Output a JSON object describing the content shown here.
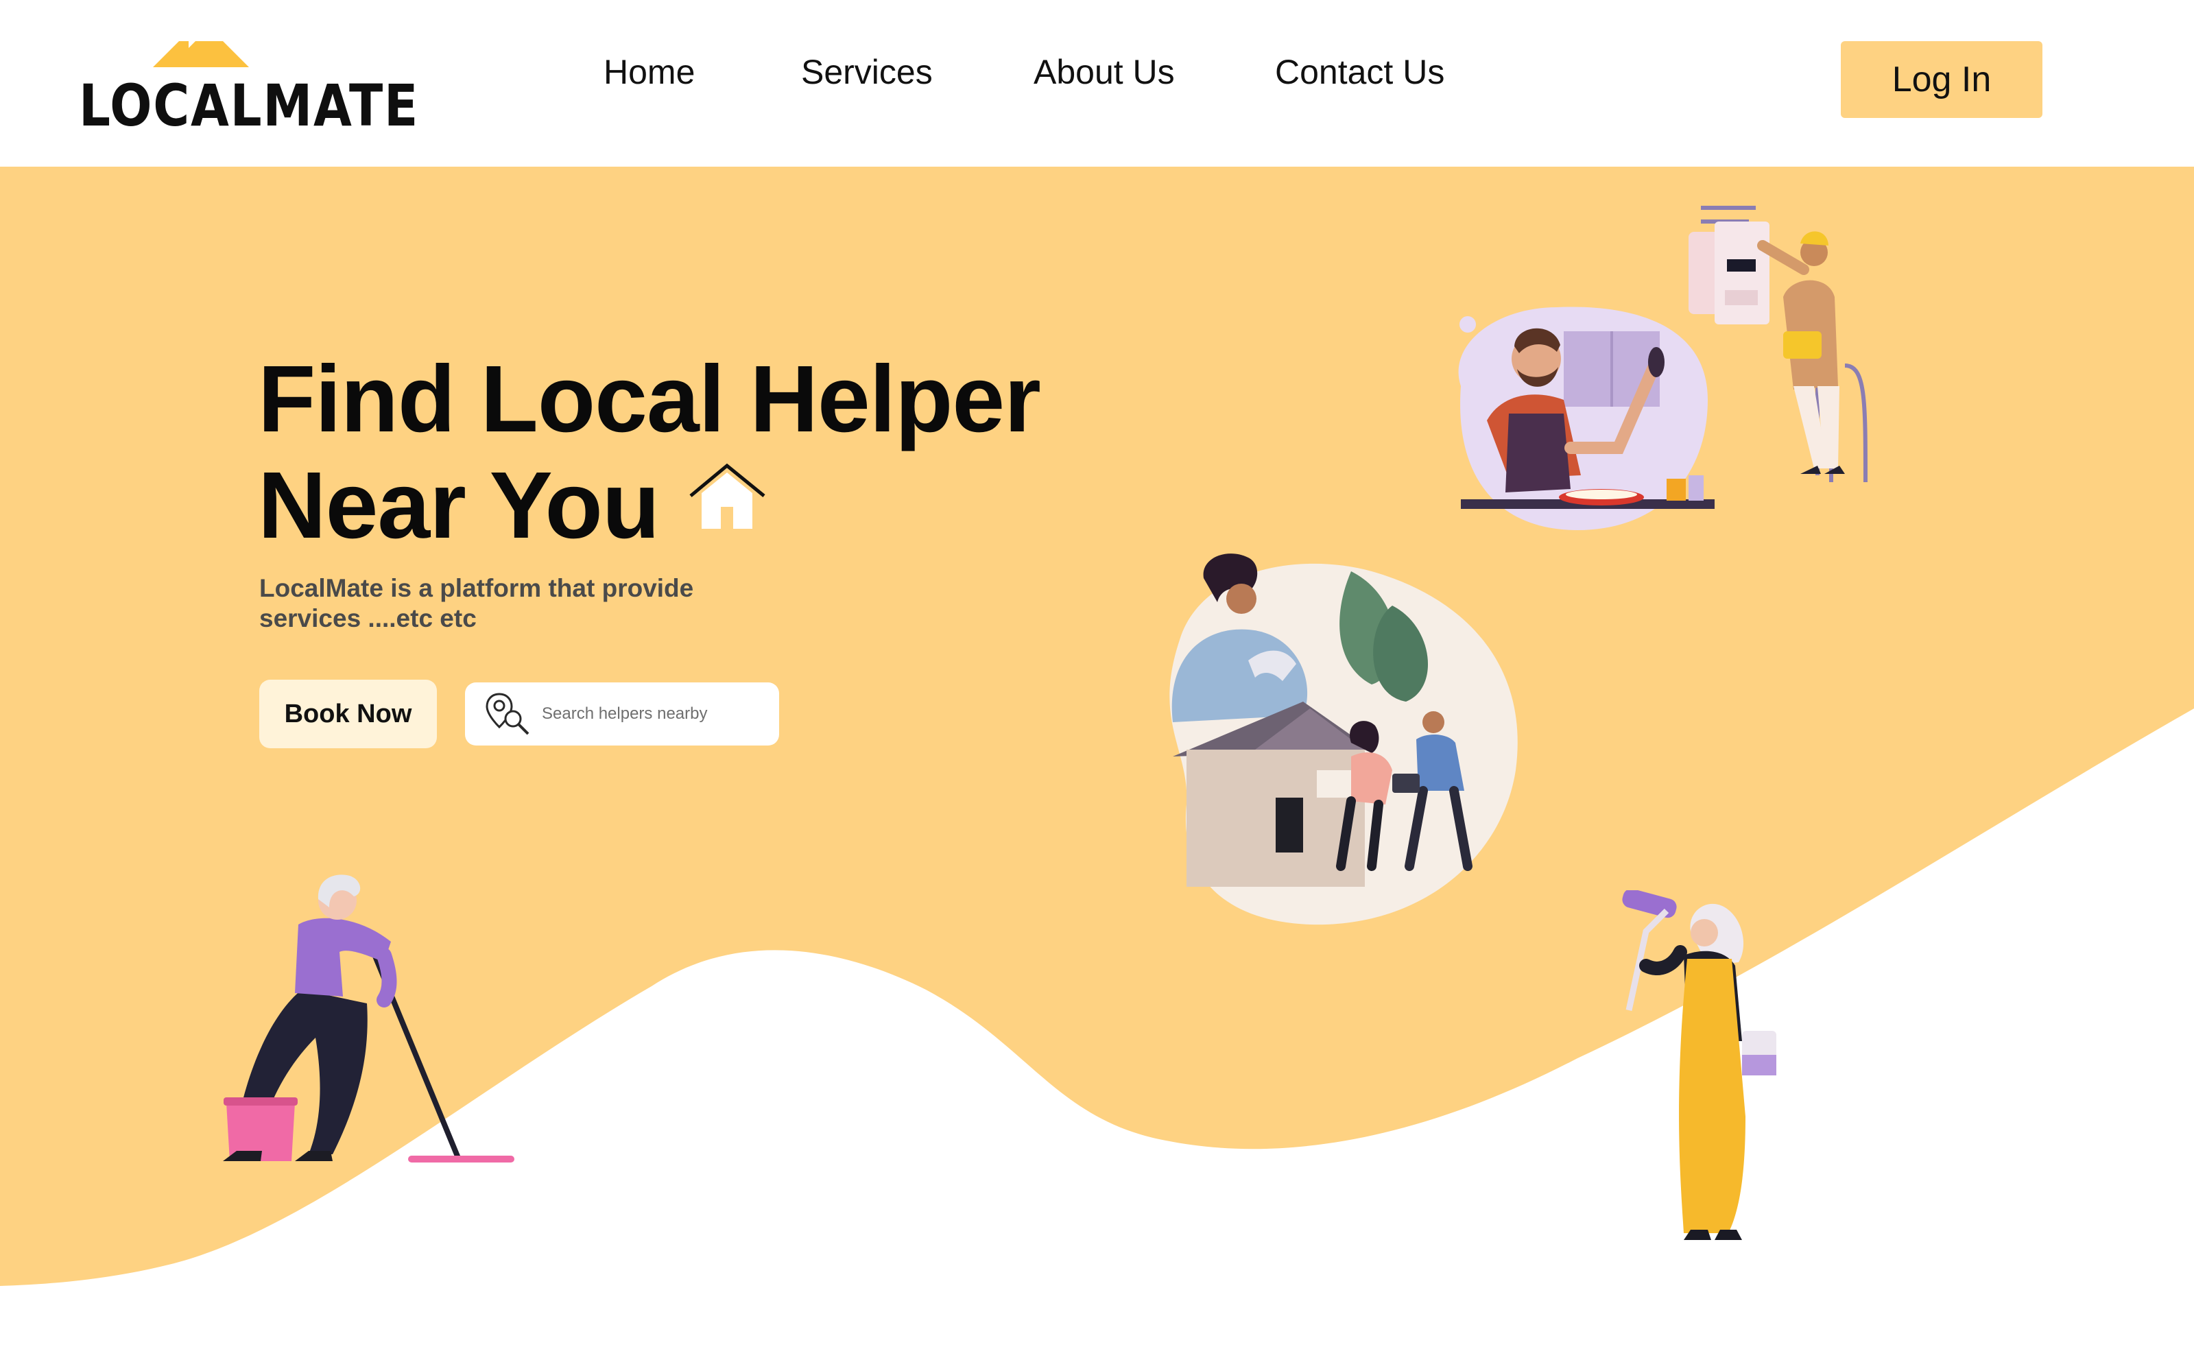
{
  "brand": {
    "name": "LOCALMATE",
    "accent": "#fed282",
    "roof_color": "#fcc13f"
  },
  "nav": {
    "items": [
      {
        "label": "Home"
      },
      {
        "label": "Services"
      },
      {
        "label": "About Us"
      },
      {
        "label": "Contact Us"
      }
    ],
    "login_label": "Log In"
  },
  "hero": {
    "headline_line1": "Find Local Helper",
    "headline_line2": "Near You",
    "headline_icon": "house-icon",
    "tagline": "LocalMate is a platform that provide services ....etc etc",
    "book_label": "Book Now",
    "search": {
      "placeholder": "Search helpers nearby",
      "value": "",
      "icon": "location-search-icon"
    },
    "background_color": "#fed282"
  },
  "illustrations": [
    {
      "name": "woman-mopping-illustration"
    },
    {
      "name": "chef-cooking-illustration"
    },
    {
      "name": "electrician-illustration"
    },
    {
      "name": "family-home-illustration"
    },
    {
      "name": "woman-painting-illustration"
    }
  ]
}
